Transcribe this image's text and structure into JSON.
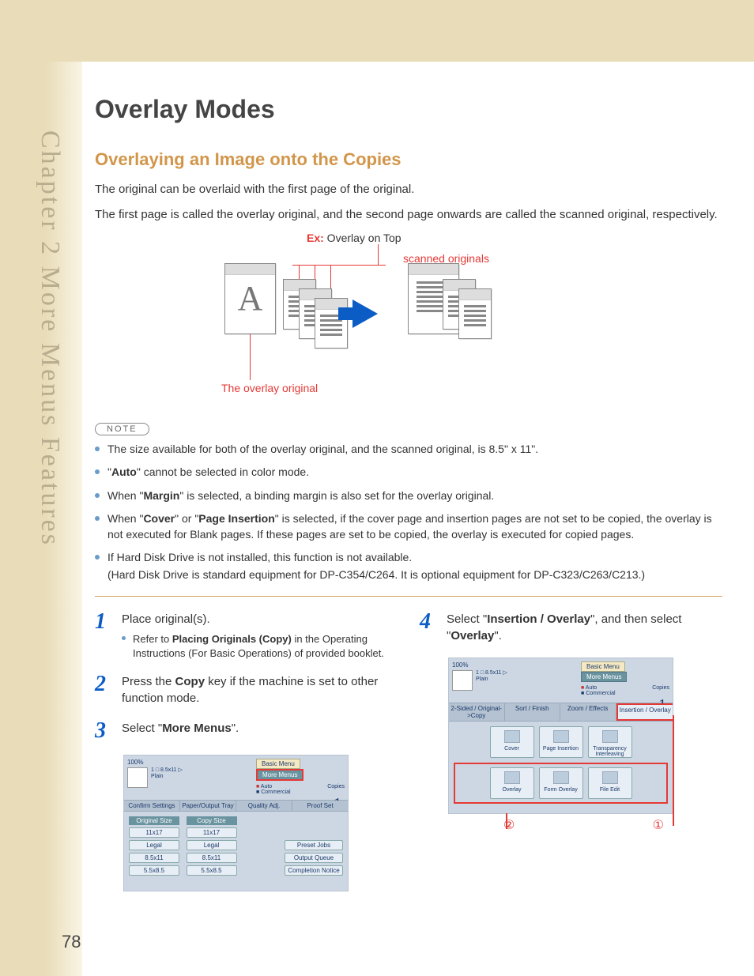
{
  "sidebar": "Chapter 2    More Menus Features",
  "title": "Overlay Modes",
  "subtitle": "Overlaying an Image onto the Copies",
  "intro1": "The original can be overlaid with the first page of the original.",
  "intro2": "The first page is called the overlay original, and the second page onwards are called the scanned original, respectively.",
  "diagram": {
    "ex_prefix": "Ex:",
    "ex_text": " Overlay on Top",
    "scanned": "scanned originals",
    "overlay": "The overlay original",
    "letter": "A"
  },
  "note_label": "NOTE",
  "notes": {
    "n1": "The size available for both of the overlay original, and the scanned original, is 8.5\" x 11\".",
    "n2a": "\"",
    "n2b": "Auto",
    "n2c": "\" cannot be selected in color mode.",
    "n3a": "When \"",
    "n3b": "Margin",
    "n3c": "\" is selected, a binding margin is also set for the overlay original.",
    "n4a": "When \"",
    "n4b": "Cover",
    "n4c": "\" or \"",
    "n4d": "Page Insertion",
    "n4e": "\" is selected, if the cover page and insertion pages are not set to be copied, the overlay is not executed for Blank pages. If these pages are set to be copied, the overlay is executed for copied pages.",
    "n5a": "If Hard Disk Drive is not installed, this function is not available.",
    "n5b": "(Hard Disk Drive is standard equipment for DP-C354/C264. It is optional equipment for DP-C323/C263/C213.)"
  },
  "steps": {
    "s1": {
      "num": "1",
      "text": "Place original(s).",
      "sub_a": "Refer to ",
      "sub_b": "Placing Originals (Copy)",
      "sub_c": " in the Operating Instructions (For Basic Operations) of provided booklet."
    },
    "s2": {
      "num": "2",
      "text_a": "Press the ",
      "text_b": "Copy",
      "text_c": " key if the machine is set to other function mode."
    },
    "s3": {
      "num": "3",
      "text_a": "Select \"",
      "text_b": "More Menus",
      "text_c": "\"."
    },
    "s4": {
      "num": "4",
      "text_a": "Select \"",
      "text_b": "Insertion / Overlay",
      "text_c": "\", and then select \"",
      "text_d": "Overlay",
      "text_e": "\"."
    }
  },
  "screen1": {
    "zoom": "100%",
    "tray": "1 □ 8.5x11 ▷",
    "plain": "Plain",
    "basic": "Basic Menu",
    "more": "More Menus",
    "auto": "Auto",
    "commercial": "Commercial",
    "copies": "Copies",
    "one": "1",
    "tabs": {
      "t1": "Confirm Settings",
      "t2": "Paper/Output Tray",
      "t3": "Quality Adj.",
      "t4": "Proof Set"
    },
    "orig_hdr": "Original Size",
    "copy_hdr": "Copy Size",
    "sizes": {
      "a": "11x17",
      "b": "Legal",
      "c": "8.5x11",
      "d": "5.5x8.5"
    },
    "right": {
      "a": "Preset Jobs",
      "b": "Output Queue",
      "c": "Completion Notice"
    }
  },
  "screen2": {
    "zoom": "100%",
    "tray": "1 □ 8.5x11 ▷",
    "plain": "Plain",
    "basic": "Basic Menu",
    "more": "More Menus",
    "auto": "Auto",
    "commercial": "Commercial",
    "copies": "Copies",
    "one": "1",
    "tabs": {
      "t1": "2-Sided / Original->Copy",
      "t2": "Sort / Finish",
      "t3": "Zoom / Effects",
      "t4": "Insertion / Overlay"
    },
    "feat1": {
      "a": "Cover",
      "b": "Page Insertion",
      "c": "Transparency Interleaving"
    },
    "feat2": {
      "a": "Overlay",
      "b": "Form Overlay",
      "c": "File Edit"
    },
    "circ1": "①",
    "circ2": "②"
  },
  "page_number": "78"
}
